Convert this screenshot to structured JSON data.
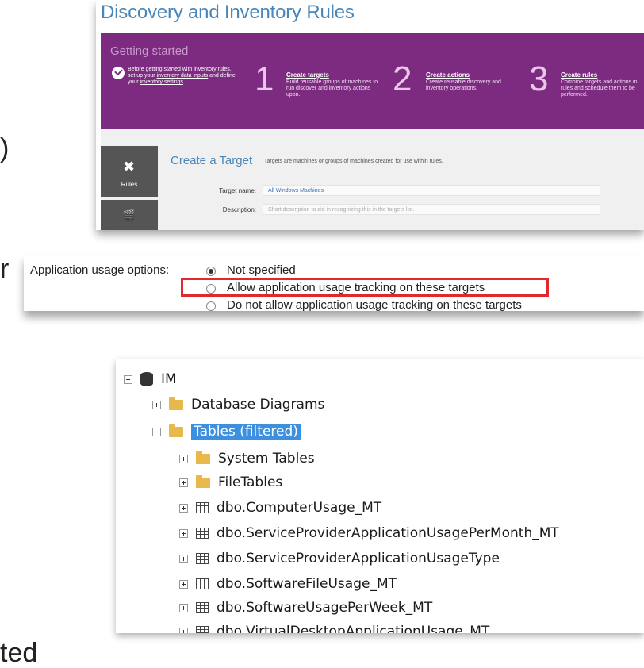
{
  "background_text": {
    "frag1": ")",
    "frag2": "r",
    "frag3": "ted"
  },
  "rules_panel": {
    "title": "Discovery and Inventory Rules",
    "getting_started": "Getting started",
    "intro_part1": "Before getting started with inventory rules, set up your ",
    "intro_link1": "inventory data inputs",
    "intro_part2": " and define your ",
    "intro_link2": "inventory settings",
    "intro_part3": ".",
    "steps": [
      {
        "num": "1",
        "heading": "Create targets",
        "desc": "Build reusable groups of machines to run discover and inventory actions upon."
      },
      {
        "num": "2",
        "heading": "Create actions",
        "desc": "Create reusable discovery and inventory operations."
      },
      {
        "num": "3",
        "heading": "Create rules",
        "desc": "Combine targets and actions in rules and schedule them to be performed."
      }
    ],
    "sidebar": {
      "rules_label": "Rules"
    },
    "create_target": {
      "heading": "Create a Target",
      "subheading": "Targets are machines or groups of machines created for use within rules.",
      "target_name_label": "Target name:",
      "target_name_value": "All Windows Machines",
      "description_label": "Description:",
      "description_placeholder": "Short description to aid in recognizing this in the targets list."
    }
  },
  "usage_options": {
    "label": "Application usage options:",
    "options": [
      {
        "text": "Not specified",
        "selected": true
      },
      {
        "text": "Allow application usage tracking on these targets",
        "selected": false
      },
      {
        "text": "Do not allow application usage tracking on these targets",
        "selected": false
      }
    ],
    "highlight_color": "#e0282e"
  },
  "object_explorer": {
    "nodes": [
      {
        "label": "IM",
        "icon": "database-icon"
      },
      {
        "label": "Database Diagrams",
        "icon": "folder-icon"
      },
      {
        "label": "Tables (filtered)",
        "icon": "folder-icon",
        "selected": true
      },
      {
        "label": "System Tables",
        "icon": "folder-icon"
      },
      {
        "label": "FileTables",
        "icon": "folder-icon"
      },
      {
        "label": "dbo.ComputerUsage_MT",
        "icon": "table-icon"
      },
      {
        "label": "dbo.ServiceProviderApplicationUsagePerMonth_MT",
        "icon": "table-icon"
      },
      {
        "label": "dbo.ServiceProviderApplicationUsageType",
        "icon": "table-icon"
      },
      {
        "label": "dbo.SoftwareFileUsage_MT",
        "icon": "table-icon"
      },
      {
        "label": "dbo.SoftwareUsagePerWeek_MT",
        "icon": "table-icon"
      },
      {
        "label": "dbo.VirtualDesktopApplicationUsage_MT",
        "icon": "table-icon"
      }
    ]
  },
  "colors": {
    "banner_purple": "#7d2b80",
    "title_blue": "#4a86b7",
    "selection_blue": "#3d8fe0",
    "folder_yellow": "#e8b84a"
  }
}
